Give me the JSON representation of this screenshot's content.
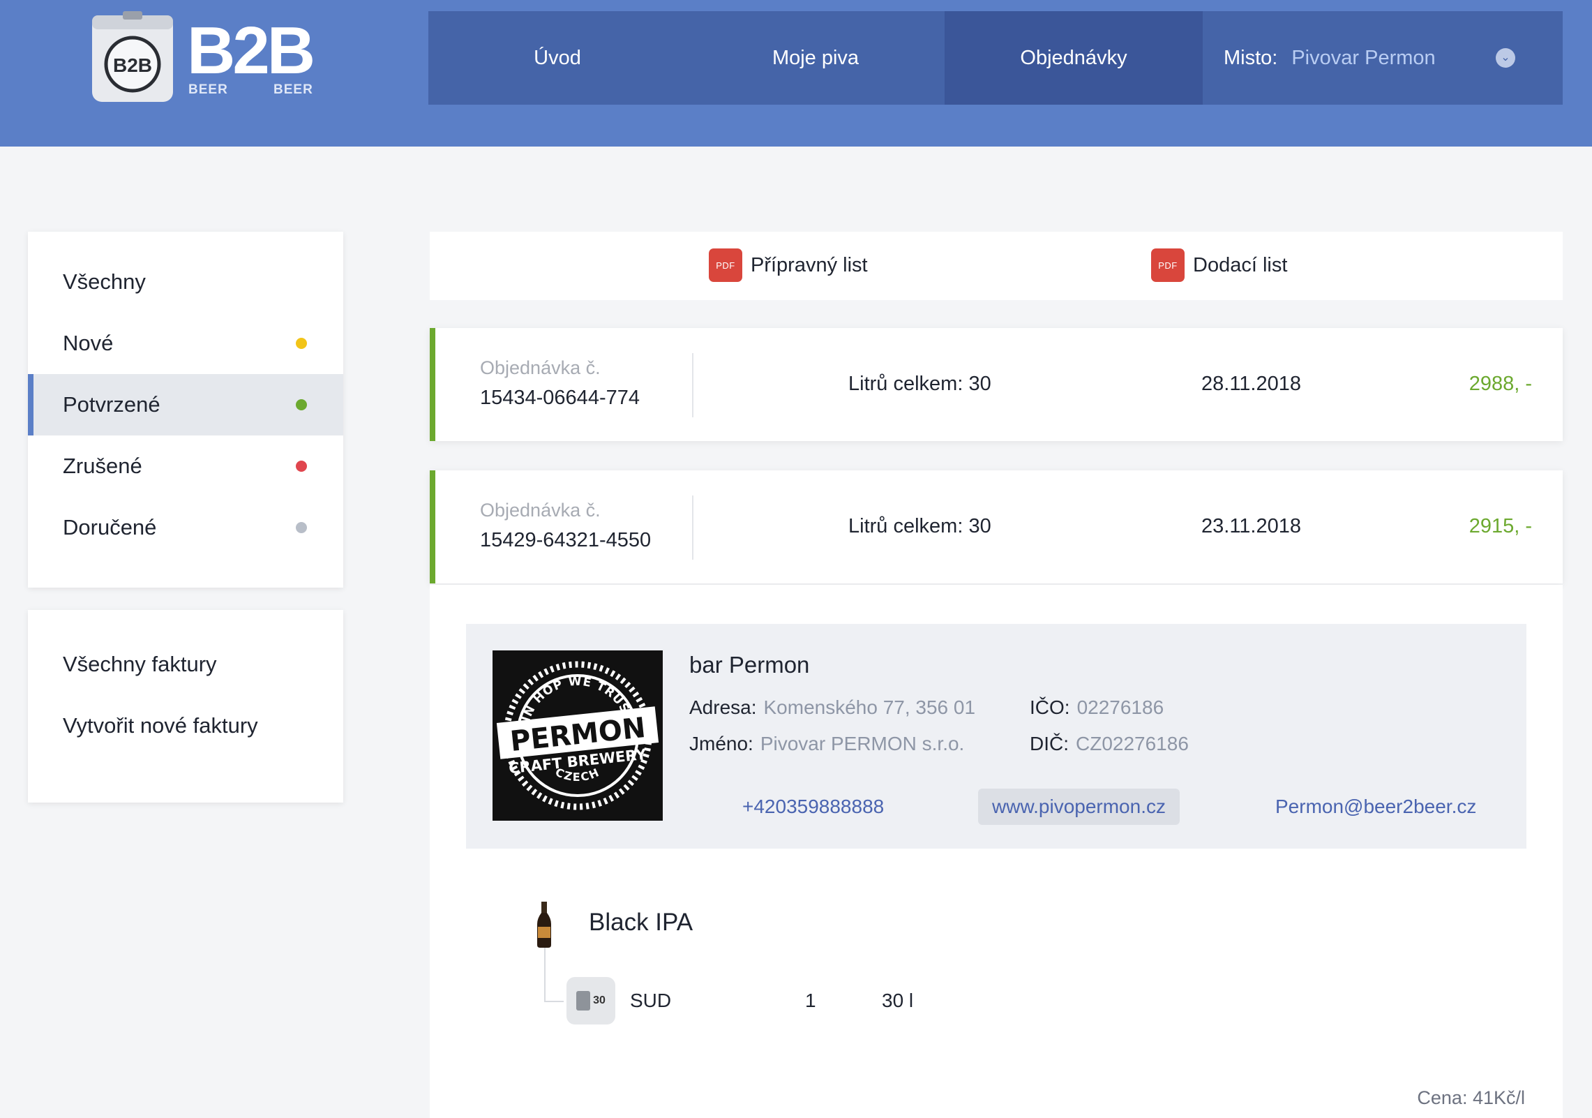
{
  "brand": {
    "logo_text": "B2B",
    "logo_sub_left": "BEER",
    "logo_sub_right": "BEER",
    "keg_badge": "B2B"
  },
  "nav": {
    "items": [
      {
        "label": "Úvod"
      },
      {
        "label": "Moje piva"
      },
      {
        "label": "Objednávky"
      }
    ],
    "active_index": 2,
    "place_label": "Misto:",
    "place_value": "Pivovar Permon"
  },
  "sidebar": {
    "status_items": [
      {
        "label": "Všechny",
        "dot_color": ""
      },
      {
        "label": "Nové",
        "dot_color": "#f2c418"
      },
      {
        "label": "Potvrzené",
        "dot_color": "#6ca92f"
      },
      {
        "label": "Zrušené",
        "dot_color": "#e0464e"
      },
      {
        "label": "Doručené",
        "dot_color": "#b8bec8"
      }
    ],
    "active_index": 2,
    "invoice_items": [
      {
        "label": "Všechny faktury"
      },
      {
        "label": "Vytvořit nové faktury"
      }
    ]
  },
  "documents": {
    "pdf_icon_text": "PDF",
    "prep_list": "Přípravný list",
    "delivery_list": "Dodací list"
  },
  "orders": [
    {
      "label": "Objednávka č.",
      "number": "15434-06644-774",
      "liters": "Litrů celkem: 30",
      "date": "28.11.2018",
      "price": "2988, -"
    },
    {
      "label": "Objednávka č.",
      "number": "15429-64321-4550",
      "liters": "Litrů celkem: 30",
      "date": "23.11.2018",
      "price": "2915, -"
    }
  ],
  "brewery": {
    "name": "bar Permon",
    "address_label": "Adresa:",
    "address_value": "Komenského 77, 356 01",
    "name_label": "Jméno:",
    "name_value": "Pivovar PERMON s.r.o.",
    "ico_label": "IČO:",
    "ico_value": "02276186",
    "dic_label": "DIČ:",
    "dic_value": "CZ02276186",
    "phone": "+420359888888",
    "web": "www.pivopermon.cz",
    "email": "Permon@beer2beer.cz",
    "logo_top": "IN HOP WE TRUST",
    "logo_main": "PERMON",
    "logo_sub": "CRAFT BREWERY",
    "logo_bottom": "CZECH"
  },
  "beer": {
    "name": "Black IPA",
    "keg_size": "30",
    "container": "SUD",
    "quantity": "1",
    "volume": "30 l",
    "price_per_liter": "Cena: 41Kč/l"
  }
}
